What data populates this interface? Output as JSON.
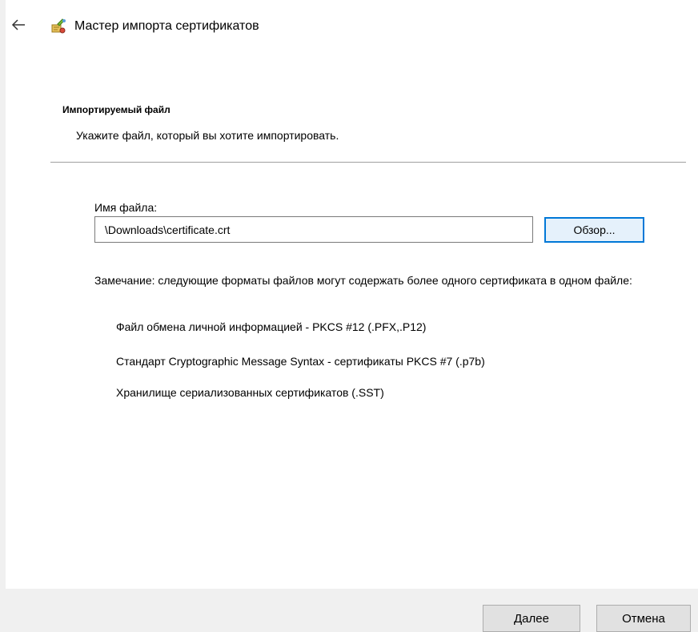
{
  "window": {
    "title": "Мастер импорта сертификатов",
    "back_icon": "arrow-left-icon",
    "app_icon": "certificate-wizard-icon"
  },
  "section": {
    "title": "Импортируемый файл",
    "subtitle": "Укажите файл, который вы хотите импортировать."
  },
  "file": {
    "label": "Имя файла:",
    "value": "\\Downloads\\certificate.crt",
    "browse_label": "Обзор..."
  },
  "note": {
    "text": "Замечание: следующие форматы файлов могут содержать более одного сертификата в одном файле:",
    "formats": [
      "Файл обмена личной информацией - PKCS #12 (.PFX,.P12)",
      "Стандарт Cryptographic Message Syntax - сертификаты PKCS #7 (.p7b)",
      "Хранилище сериализованных сертификатов (.SST)"
    ]
  },
  "footer": {
    "next_label": "Далее",
    "cancel_label": "Отмена"
  },
  "colors": {
    "accent": "#0078d7",
    "footer_background": "#f0f0f0",
    "button_background": "#e1e1e1"
  }
}
